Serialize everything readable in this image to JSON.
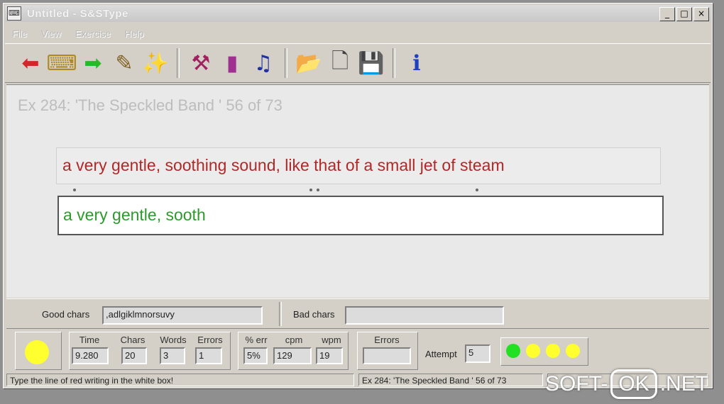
{
  "window": {
    "title": "Untitled - S&SType",
    "buttons": [
      "_",
      "□",
      "×"
    ]
  },
  "menu": [
    "File",
    "View",
    "Exercise",
    "Help"
  ],
  "toolbar": {
    "buttons": [
      {
        "icon": "red-left-arrow-icon",
        "glyph": "⬅",
        "color": "#d02828"
      },
      {
        "icon": "keyboard-icon",
        "glyph": "⌨",
        "color": "#b08a20"
      },
      {
        "icon": "green-right-arrow-icon",
        "glyph": "➡",
        "color": "#28b828"
      },
      {
        "icon": "pen-icon",
        "glyph": "✎",
        "color": "#806020"
      },
      {
        "icon": "magic-wand-icon",
        "glyph": "✨",
        "color": "#b050b0"
      },
      {
        "icon": "cursor-tool-icon",
        "glyph": "⚒",
        "color": "#a02060"
      },
      {
        "icon": "bar-chart-icon",
        "glyph": "▮",
        "color": "#a03090"
      },
      {
        "icon": "music-notes-icon",
        "glyph": "♫",
        "color": "#2030a0"
      },
      {
        "icon": "open-folder-icon",
        "glyph": "📂",
        "color": "#c0a000"
      },
      {
        "icon": "new-document-icon",
        "glyph": "🗋",
        "color": "#404040"
      },
      {
        "icon": "save-disk-icon",
        "glyph": "💾",
        "color": "#404040"
      },
      {
        "icon": "info-book-icon",
        "glyph": "ℹ",
        "color": "#2040c0"
      }
    ]
  },
  "exercise": {
    "title": "Ex 284: 'The Speckled Band ' 56 of 73",
    "target_text": "a very gentle, soothing sound, like that of a small jet of steam",
    "typed_text": "a very gentle, sooth"
  },
  "chars": {
    "good_label": "Good chars",
    "good_value": ",adlgiklmnorsuvy",
    "bad_label": "Bad chars",
    "bad_value": ""
  },
  "stats": {
    "time_label": "Time",
    "time_value": "9.280",
    "chars_label": "Chars",
    "chars_value": "20",
    "words_label": "Words",
    "words_value": "3",
    "errors_label": "Errors",
    "errors_value": "1",
    "pct_err_label": "% err",
    "pct_err_value": "5%",
    "cpm_label": "cpm",
    "cpm_value": "129",
    "wpm_label": "wpm",
    "wpm_value": "19",
    "errors2_label": "Errors",
    "errors2_value": "",
    "attempt_label": "Attempt",
    "attempt_value": "5",
    "indicator_colors": [
      "#22e022",
      "#ffff30",
      "#ffff30",
      "#ffff30"
    ],
    "status_light_color": "#ffff30"
  },
  "status": {
    "left": "Type the line of red writing in the white box!",
    "right": "Ex 284: 'The Speckled Band ' 56 of 73"
  },
  "watermark": {
    "left": "SOFT-",
    "boxed": "OK",
    "right": ".NET"
  }
}
